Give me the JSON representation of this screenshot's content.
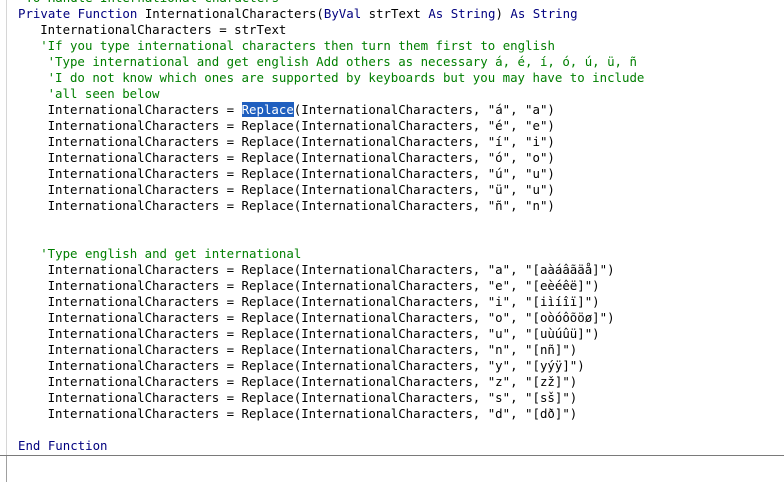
{
  "code": {
    "lines": [
      {
        "indent": 0,
        "segments": [
          {
            "t": "cm",
            "v": "'To Handle International Characters"
          }
        ]
      },
      {
        "indent": 0,
        "segments": [
          {
            "t": "kw",
            "v": "Private Function "
          },
          {
            "t": "tx",
            "v": "InternationalCharacters("
          },
          {
            "t": "kw",
            "v": "ByVal "
          },
          {
            "t": "tx",
            "v": "strText "
          },
          {
            "t": "kw",
            "v": "As String"
          },
          {
            "t": "tx",
            "v": ") "
          },
          {
            "t": "kw",
            "v": "As String"
          }
        ]
      },
      {
        "indent": 3,
        "segments": [
          {
            "t": "tx",
            "v": "InternationalCharacters = strText"
          }
        ]
      },
      {
        "indent": 3,
        "segments": [
          {
            "t": "cm",
            "v": "'If you type international characters then turn them first to english"
          }
        ]
      },
      {
        "indent": 4,
        "segments": [
          {
            "t": "cm",
            "v": "'Type international and get english Add others as necessary á, é, í, ó, ú, ü, ñ"
          }
        ]
      },
      {
        "indent": 4,
        "segments": [
          {
            "t": "cm",
            "v": "'I do not know which ones are supported by keyboards but you may have to include"
          }
        ]
      },
      {
        "indent": 4,
        "segments": [
          {
            "t": "cm",
            "v": "'all seen below"
          }
        ]
      },
      {
        "indent": 4,
        "segments": [
          {
            "t": "tx",
            "v": "InternationalCharacters = "
          },
          {
            "t": "sel",
            "v": "Replace"
          },
          {
            "t": "tx",
            "v": "(InternationalCharacters, \"á\", \"a\")"
          }
        ]
      },
      {
        "indent": 4,
        "segments": [
          {
            "t": "tx",
            "v": "InternationalCharacters = Replace(InternationalCharacters, \"é\", \"e\")"
          }
        ]
      },
      {
        "indent": 4,
        "segments": [
          {
            "t": "tx",
            "v": "InternationalCharacters = Replace(InternationalCharacters, \"í\", \"i\")"
          }
        ]
      },
      {
        "indent": 4,
        "segments": [
          {
            "t": "tx",
            "v": "InternationalCharacters = Replace(InternationalCharacters, \"ó\", \"o\")"
          }
        ]
      },
      {
        "indent": 4,
        "segments": [
          {
            "t": "tx",
            "v": "InternationalCharacters = Replace(InternationalCharacters, \"ú\", \"u\")"
          }
        ]
      },
      {
        "indent": 4,
        "segments": [
          {
            "t": "tx",
            "v": "InternationalCharacters = Replace(InternationalCharacters, \"ü\", \"u\")"
          }
        ]
      },
      {
        "indent": 4,
        "segments": [
          {
            "t": "tx",
            "v": "InternationalCharacters = Replace(InternationalCharacters, \"ñ\", \"n\")"
          }
        ]
      },
      {
        "indent": 0,
        "segments": []
      },
      {
        "indent": 0,
        "segments": []
      },
      {
        "indent": 3,
        "segments": [
          {
            "t": "cm",
            "v": "'Type english and get international"
          }
        ]
      },
      {
        "indent": 4,
        "segments": [
          {
            "t": "tx",
            "v": "InternationalCharacters = Replace(InternationalCharacters, \"a\", \"[aàáâãäå]\")"
          }
        ]
      },
      {
        "indent": 4,
        "segments": [
          {
            "t": "tx",
            "v": "InternationalCharacters = Replace(InternationalCharacters, \"e\", \"[eèéêë]\")"
          }
        ]
      },
      {
        "indent": 4,
        "segments": [
          {
            "t": "tx",
            "v": "InternationalCharacters = Replace(InternationalCharacters, \"i\", \"[iìíîï]\")"
          }
        ]
      },
      {
        "indent": 4,
        "segments": [
          {
            "t": "tx",
            "v": "InternationalCharacters = Replace(InternationalCharacters, \"o\", \"[oòóôõöø]\")"
          }
        ]
      },
      {
        "indent": 4,
        "segments": [
          {
            "t": "tx",
            "v": "InternationalCharacters = Replace(InternationalCharacters, \"u\", \"[uùúûü]\")"
          }
        ]
      },
      {
        "indent": 4,
        "segments": [
          {
            "t": "tx",
            "v": "InternationalCharacters = Replace(InternationalCharacters, \"n\", \"[nñ]\")"
          }
        ]
      },
      {
        "indent": 4,
        "segments": [
          {
            "t": "tx",
            "v": "InternationalCharacters = Replace(InternationalCharacters, \"y\", \"[yýÿ]\")"
          }
        ]
      },
      {
        "indent": 4,
        "segments": [
          {
            "t": "tx",
            "v": "InternationalCharacters = Replace(InternationalCharacters, \"z\", \"[zž]\")"
          }
        ]
      },
      {
        "indent": 4,
        "segments": [
          {
            "t": "tx",
            "v": "InternationalCharacters = Replace(InternationalCharacters, \"s\", \"[sš]\")"
          }
        ]
      },
      {
        "indent": 4,
        "segments": [
          {
            "t": "tx",
            "v": "InternationalCharacters = Replace(InternationalCharacters, \"d\", \"[dð]\")"
          }
        ]
      },
      {
        "indent": 0,
        "segments": []
      },
      {
        "indent": 0,
        "segments": [
          {
            "t": "kw",
            "v": "End Function"
          }
        ]
      }
    ]
  }
}
